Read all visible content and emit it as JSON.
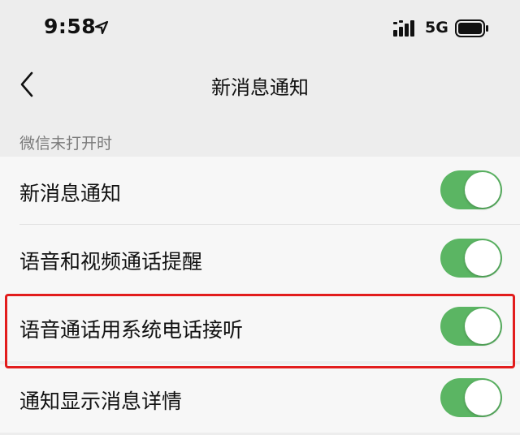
{
  "status_bar": {
    "time": "9:58",
    "network": "5G",
    "icons": [
      "location-arrow-icon",
      "signal-icon",
      "battery-icon"
    ]
  },
  "nav": {
    "title": "新消息通知",
    "back_icon": "chevron-left-icon"
  },
  "section": {
    "header": "微信未打开时"
  },
  "settings": [
    {
      "label": "新消息通知",
      "enabled": true
    },
    {
      "label": "语音和视频通话提醒",
      "enabled": true
    },
    {
      "label": "语音通话用系统电话接听",
      "enabled": true,
      "highlighted": true
    },
    {
      "label": "通知显示消息详情",
      "enabled": true
    }
  ],
  "colors": {
    "toggle_on": "#5bb563",
    "highlight": "#e21c1c",
    "page_background": "#ededed",
    "row_background": "#f7f7f7"
  }
}
